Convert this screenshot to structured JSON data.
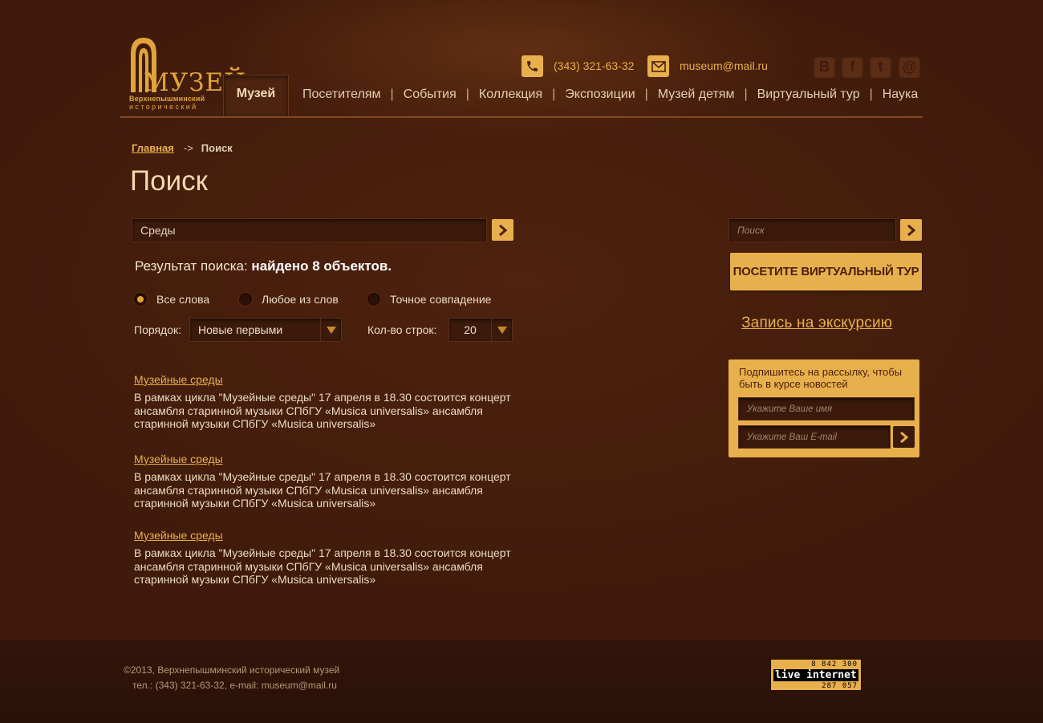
{
  "logo": {
    "word": "МУЗЕЙ",
    "line1": "Верхнепышминский",
    "line2": "исторический"
  },
  "header": {
    "phone": "(343) 321-63-32",
    "email": "museum@mail.ru",
    "social": {
      "vk_letter": "В",
      "fb_letter": "f",
      "tw_letter": "t",
      "mail_letter": "@"
    },
    "nav": {
      "active": "Музей",
      "items": [
        "Посетителям",
        "События",
        "Коллекция",
        "Экспозиции",
        "Музей детям",
        "Виртуальный тур",
        "Наука"
      ],
      "separator": "|"
    }
  },
  "breadcrumb": {
    "home": "Главная",
    "arrow": "->",
    "current": "Поиск"
  },
  "page_title": "Поиск",
  "search": {
    "value": "Среды",
    "result_prefix": "Результат поиска:",
    "result_bold": "найдено 8 объектов.",
    "modes": {
      "all": "Все слова",
      "any": "Любое из слов",
      "exact": "Точное совпадение",
      "selected": "all"
    },
    "order_label": "Порядок:",
    "order_value": "Новые первыми",
    "rows_label": "Кол-во строк:",
    "rows_value": "20"
  },
  "results": [
    {
      "title": "Музейные среды",
      "text": "В рамках цикла \"Музейные среды\" 17 апреля в 18.30 состоится концерт ансамбля старинной музыки СПбГУ  «Musica universalis» ансамбля старинной музыки СПбГУ  «Musica universalis»"
    },
    {
      "title": "Музейные среды",
      "text": "В рамках цикла \"Музейные среды\" 17 апреля в 18.30 состоится концерт ансамбля старинной музыки СПбГУ  «Musica universalis» ансамбля старинной музыки СПбГУ  «Musica universalis»"
    },
    {
      "title": "Музейные среды",
      "text": "В рамках цикла \"Музейные среды\" 17 апреля в 18.30 состоится концерт ансамбля старинной музыки СПбГУ  «Musica universalis» ансамбля старинной музыки СПбГУ  «Musica universalis»"
    }
  ],
  "sidebar": {
    "search_placeholder": "Поиск",
    "tour_button": "ПОСЕТИТЕ ВИРТУАЛЬНЫЙ ТУР",
    "excursion_link": "Запись на экскурсию",
    "subscribe": {
      "title": "Подпишитесь на рассылку, чтобы быть в курсе новостей",
      "name_placeholder": "Укажите Ваше имя",
      "email_placeholder": "Укажите Ваш E-mail"
    }
  },
  "footer": {
    "copyright": "©2013, Верхнепышминский исторический музей",
    "contacts": "тел.: (343) 321-63-32, e-mail: museum@mail.ru",
    "counter": {
      "top": "8 842 300",
      "label": "live internet",
      "bottom": "287 057"
    }
  },
  "colors": {
    "background": "#401b0b",
    "accent": "#e8b04c",
    "text": "#eadbc3"
  }
}
